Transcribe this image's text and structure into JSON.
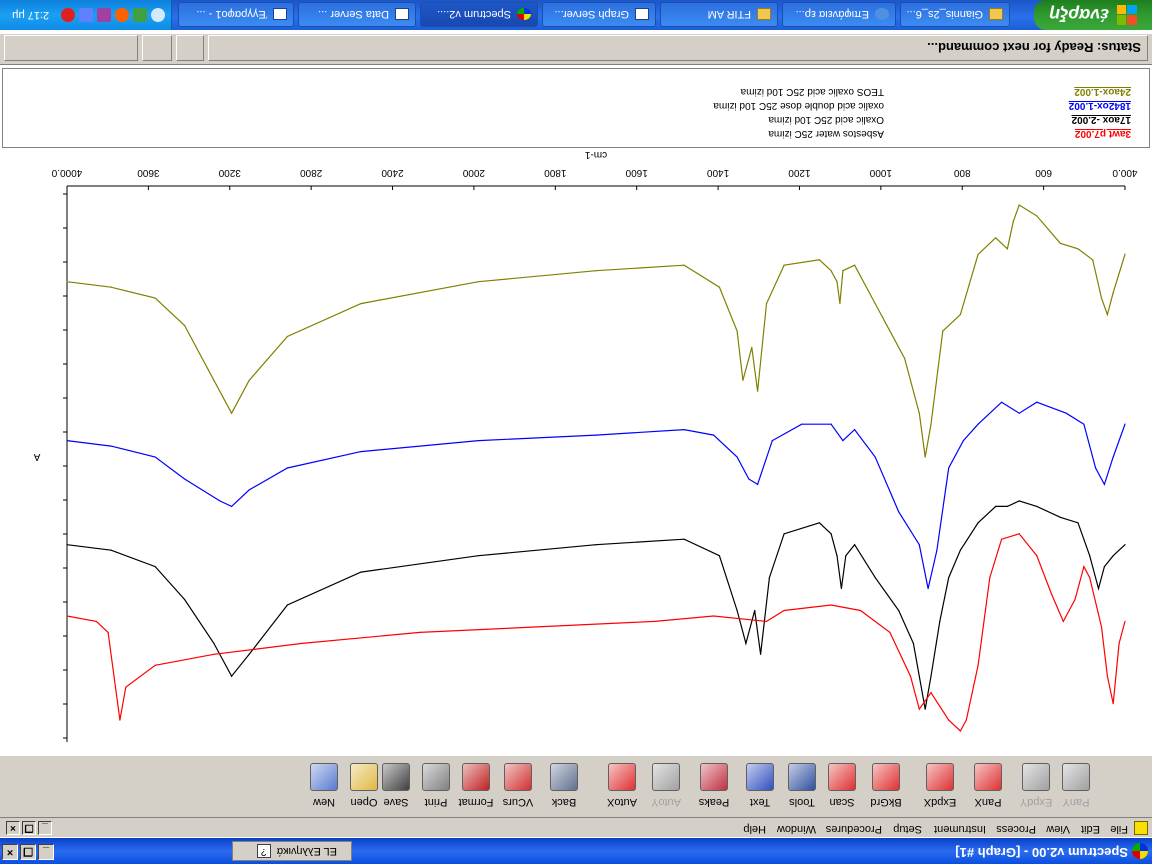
{
  "window": {
    "title": "Spectrum v2.00 - [Graph #1]",
    "language_indicator": "EL Ελληνικά"
  },
  "taskbar": {
    "start_label": "έναρξη",
    "buttons": [
      {
        "label": "Giannis_2s_6...",
        "icon": "folder-icon"
      },
      {
        "label": "Επιφάνεια ερ...",
        "icon": "ie-icon"
      },
      {
        "label": "FTIR AM",
        "icon": "folder-icon"
      },
      {
        "label": "Graph Server...",
        "icon": "window-icon"
      },
      {
        "label": "Spectrum v2....",
        "icon": "spectrum-icon"
      },
      {
        "label": "Data Server ...",
        "icon": "window-icon"
      },
      {
        "label": "Έγγραφο1 - ...",
        "icon": "word-icon"
      }
    ],
    "clock": "2:17 μμ"
  },
  "status": {
    "text": "Status: Ready for next command..."
  },
  "legend": [
    {
      "name": "24aox-1.002",
      "desc": "TEOS oxalic acid 25C 10d izima",
      "color": "#808000"
    },
    {
      "name": "1842ox-1.002",
      "desc": "oxalic acid double dose 25C 10d izima",
      "color": "#0000ff"
    },
    {
      "name": "17aox -2.002",
      "desc": "Oxalic acid 25C 10d izima",
      "color": "#000000"
    },
    {
      "name": "3awt p7.002",
      "desc": "Asbestos water 25C izima",
      "color": "#ff0000"
    }
  ],
  "chart_data": {
    "type": "line",
    "xlabel": "cm-1",
    "ylabel": "A",
    "xlim": [
      4000.0,
      400.0
    ],
    "x_ticks": [
      "4000.0",
      "3600",
      "3200",
      "2800",
      "2400",
      "2000",
      "1800",
      "1600",
      "1400",
      "1200",
      "1000",
      "800",
      "600",
      "400.0"
    ],
    "series": [
      {
        "name": "24aox-1.002",
        "color": "#808000",
        "points": [
          [
            4000,
            0.84
          ],
          [
            3850,
            0.83
          ],
          [
            3700,
            0.81
          ],
          [
            3600,
            0.76
          ],
          [
            3500,
            0.66
          ],
          [
            3440,
            0.6
          ],
          [
            3380,
            0.66
          ],
          [
            3250,
            0.74
          ],
          [
            3000,
            0.8
          ],
          [
            2600,
            0.84
          ],
          [
            2200,
            0.86
          ],
          [
            1900,
            0.87
          ],
          [
            1780,
            0.83
          ],
          [
            1720,
            0.75
          ],
          [
            1700,
            0.66
          ],
          [
            1670,
            0.72
          ],
          [
            1650,
            0.64
          ],
          [
            1620,
            0.8
          ],
          [
            1560,
            0.87
          ],
          [
            1440,
            0.88
          ],
          [
            1400,
            0.86
          ],
          [
            1380,
            0.84
          ],
          [
            1370,
            0.8
          ],
          [
            1360,
            0.86
          ],
          [
            1320,
            0.87
          ],
          [
            1250,
            0.8
          ],
          [
            1150,
            0.7
          ],
          [
            1100,
            0.6
          ],
          [
            1080,
            0.52
          ],
          [
            1060,
            0.58
          ],
          [
            1020,
            0.75
          ],
          [
            960,
            0.78
          ],
          [
            900,
            0.89
          ],
          [
            840,
            0.92
          ],
          [
            800,
            0.9
          ],
          [
            780,
            0.95
          ],
          [
            760,
            0.98
          ],
          [
            700,
            0.96
          ],
          [
            620,
            0.91
          ],
          [
            560,
            0.9
          ],
          [
            510,
            0.88
          ],
          [
            480,
            0.81
          ],
          [
            460,
            0.78
          ],
          [
            440,
            0.82
          ],
          [
            400,
            0.89
          ]
        ]
      },
      {
        "name": "1842ox-1.002",
        "color": "#0000ff",
        "points": [
          [
            4000,
            0.55
          ],
          [
            3850,
            0.54
          ],
          [
            3700,
            0.52
          ],
          [
            3600,
            0.48
          ],
          [
            3480,
            0.44
          ],
          [
            3440,
            0.43
          ],
          [
            3380,
            0.46
          ],
          [
            3250,
            0.5
          ],
          [
            3000,
            0.53
          ],
          [
            2600,
            0.55
          ],
          [
            2200,
            0.56
          ],
          [
            1900,
            0.57
          ],
          [
            1800,
            0.56
          ],
          [
            1720,
            0.52
          ],
          [
            1680,
            0.48
          ],
          [
            1650,
            0.47
          ],
          [
            1600,
            0.55
          ],
          [
            1500,
            0.58
          ],
          [
            1400,
            0.58
          ],
          [
            1360,
            0.55
          ],
          [
            1320,
            0.57
          ],
          [
            1250,
            0.52
          ],
          [
            1170,
            0.42
          ],
          [
            1100,
            0.36
          ],
          [
            1070,
            0.28
          ],
          [
            1040,
            0.35
          ],
          [
            1000,
            0.5
          ],
          [
            950,
            0.55
          ],
          [
            900,
            0.58
          ],
          [
            820,
            0.62
          ],
          [
            760,
            0.6
          ],
          [
            700,
            0.62
          ],
          [
            600,
            0.6
          ],
          [
            540,
            0.58
          ],
          [
            500,
            0.5
          ],
          [
            470,
            0.47
          ],
          [
            440,
            0.52
          ],
          [
            400,
            0.58
          ]
        ]
      },
      {
        "name": "17aox -2.002",
        "color": "#000000",
        "points": [
          [
            4000,
            0.36
          ],
          [
            3850,
            0.35
          ],
          [
            3700,
            0.32
          ],
          [
            3600,
            0.26
          ],
          [
            3500,
            0.18
          ],
          [
            3440,
            0.12
          ],
          [
            3380,
            0.16
          ],
          [
            3250,
            0.25
          ],
          [
            3000,
            0.31
          ],
          [
            2600,
            0.34
          ],
          [
            2200,
            0.36
          ],
          [
            1900,
            0.37
          ],
          [
            1780,
            0.34
          ],
          [
            1720,
            0.24
          ],
          [
            1690,
            0.18
          ],
          [
            1660,
            0.24
          ],
          [
            1640,
            0.16
          ],
          [
            1610,
            0.3
          ],
          [
            1560,
            0.38
          ],
          [
            1440,
            0.4
          ],
          [
            1400,
            0.38
          ],
          [
            1380,
            0.34
          ],
          [
            1365,
            0.28
          ],
          [
            1350,
            0.34
          ],
          [
            1320,
            0.36
          ],
          [
            1250,
            0.3
          ],
          [
            1170,
            0.24
          ],
          [
            1120,
            0.18
          ],
          [
            1080,
            0.06
          ],
          [
            1060,
            0.12
          ],
          [
            1030,
            0.22
          ],
          [
            1000,
            0.3
          ],
          [
            960,
            0.35
          ],
          [
            900,
            0.4
          ],
          [
            840,
            0.43
          ],
          [
            800,
            0.43
          ],
          [
            760,
            0.44
          ],
          [
            700,
            0.43
          ],
          [
            620,
            0.41
          ],
          [
            560,
            0.4
          ],
          [
            520,
            0.34
          ],
          [
            490,
            0.28
          ],
          [
            470,
            0.32
          ],
          [
            440,
            0.34
          ],
          [
            400,
            0.36
          ]
        ]
      },
      {
        "name": "3awt p7.002",
        "color": "#ff0000",
        "points": [
          [
            4000,
            0.23
          ],
          [
            3900,
            0.22
          ],
          [
            3860,
            0.2
          ],
          [
            3840,
            0.12
          ],
          [
            3820,
            0.04
          ],
          [
            3800,
            0.1
          ],
          [
            3700,
            0.14
          ],
          [
            3500,
            0.16
          ],
          [
            3200,
            0.18
          ],
          [
            2800,
            0.2
          ],
          [
            2400,
            0.21
          ],
          [
            2000,
            0.22
          ],
          [
            1800,
            0.23
          ],
          [
            1620,
            0.22
          ],
          [
            1560,
            0.24
          ],
          [
            1400,
            0.25
          ],
          [
            1300,
            0.24
          ],
          [
            1200,
            0.2
          ],
          [
            1130,
            0.12
          ],
          [
            1100,
            0.06
          ],
          [
            1060,
            0.09
          ],
          [
            1000,
            0.04
          ],
          [
            960,
            0.02
          ],
          [
            940,
            0.04
          ],
          [
            900,
            0.14
          ],
          [
            860,
            0.3
          ],
          [
            820,
            0.37
          ],
          [
            760,
            0.38
          ],
          [
            700,
            0.34
          ],
          [
            650,
            0.27
          ],
          [
            610,
            0.22
          ],
          [
            570,
            0.26
          ],
          [
            540,
            0.32
          ],
          [
            520,
            0.3
          ],
          [
            480,
            0.21
          ],
          [
            460,
            0.12
          ],
          [
            440,
            0.07
          ],
          [
            420,
            0.18
          ],
          [
            400,
            0.22
          ]
        ]
      }
    ]
  },
  "toolbar": {
    "buttons": [
      {
        "label": "New",
        "icon": "new-document-icon",
        "enabled": true
      },
      {
        "label": "Open",
        "icon": "open-folder-icon",
        "enabled": true
      },
      {
        "label": "Save",
        "icon": "save-disk-icon",
        "enabled": true
      },
      {
        "label": "Print",
        "icon": "printer-icon",
        "enabled": true
      },
      {
        "label": "Format",
        "icon": "format-axes-icon",
        "enabled": true
      },
      {
        "label": "VCurs",
        "icon": "vertical-cursor-icon",
        "enabled": true
      },
      {
        "label": "Back",
        "icon": "back-icon",
        "enabled": true
      },
      {
        "label": "AutoX",
        "icon": "auto-x-icon",
        "enabled": true
      },
      {
        "label": "AutoY",
        "icon": "auto-y-icon",
        "enabled": false
      },
      {
        "label": "Peaks",
        "icon": "peaks-icon",
        "enabled": true
      },
      {
        "label": "Text",
        "icon": "text-abc-icon",
        "enabled": true
      },
      {
        "label": "Tools",
        "icon": "tools-icon",
        "enabled": true
      },
      {
        "label": "Scan",
        "icon": "scan-icon",
        "enabled": true
      },
      {
        "label": "BkGrd",
        "icon": "background-icon",
        "enabled": true
      },
      {
        "label": "ExpdX",
        "icon": "expand-x-icon",
        "enabled": true
      },
      {
        "label": "PanX",
        "icon": "pan-x-icon",
        "enabled": true
      },
      {
        "label": "ExpdY",
        "icon": "expand-y-icon",
        "enabled": false
      },
      {
        "label": "PanY",
        "icon": "pan-y-icon",
        "enabled": false
      }
    ]
  },
  "menubar": {
    "items": [
      "File",
      "Edit",
      "View",
      "Process",
      "Instrument",
      "Setup",
      "Procedures",
      "Window",
      "Help"
    ]
  }
}
